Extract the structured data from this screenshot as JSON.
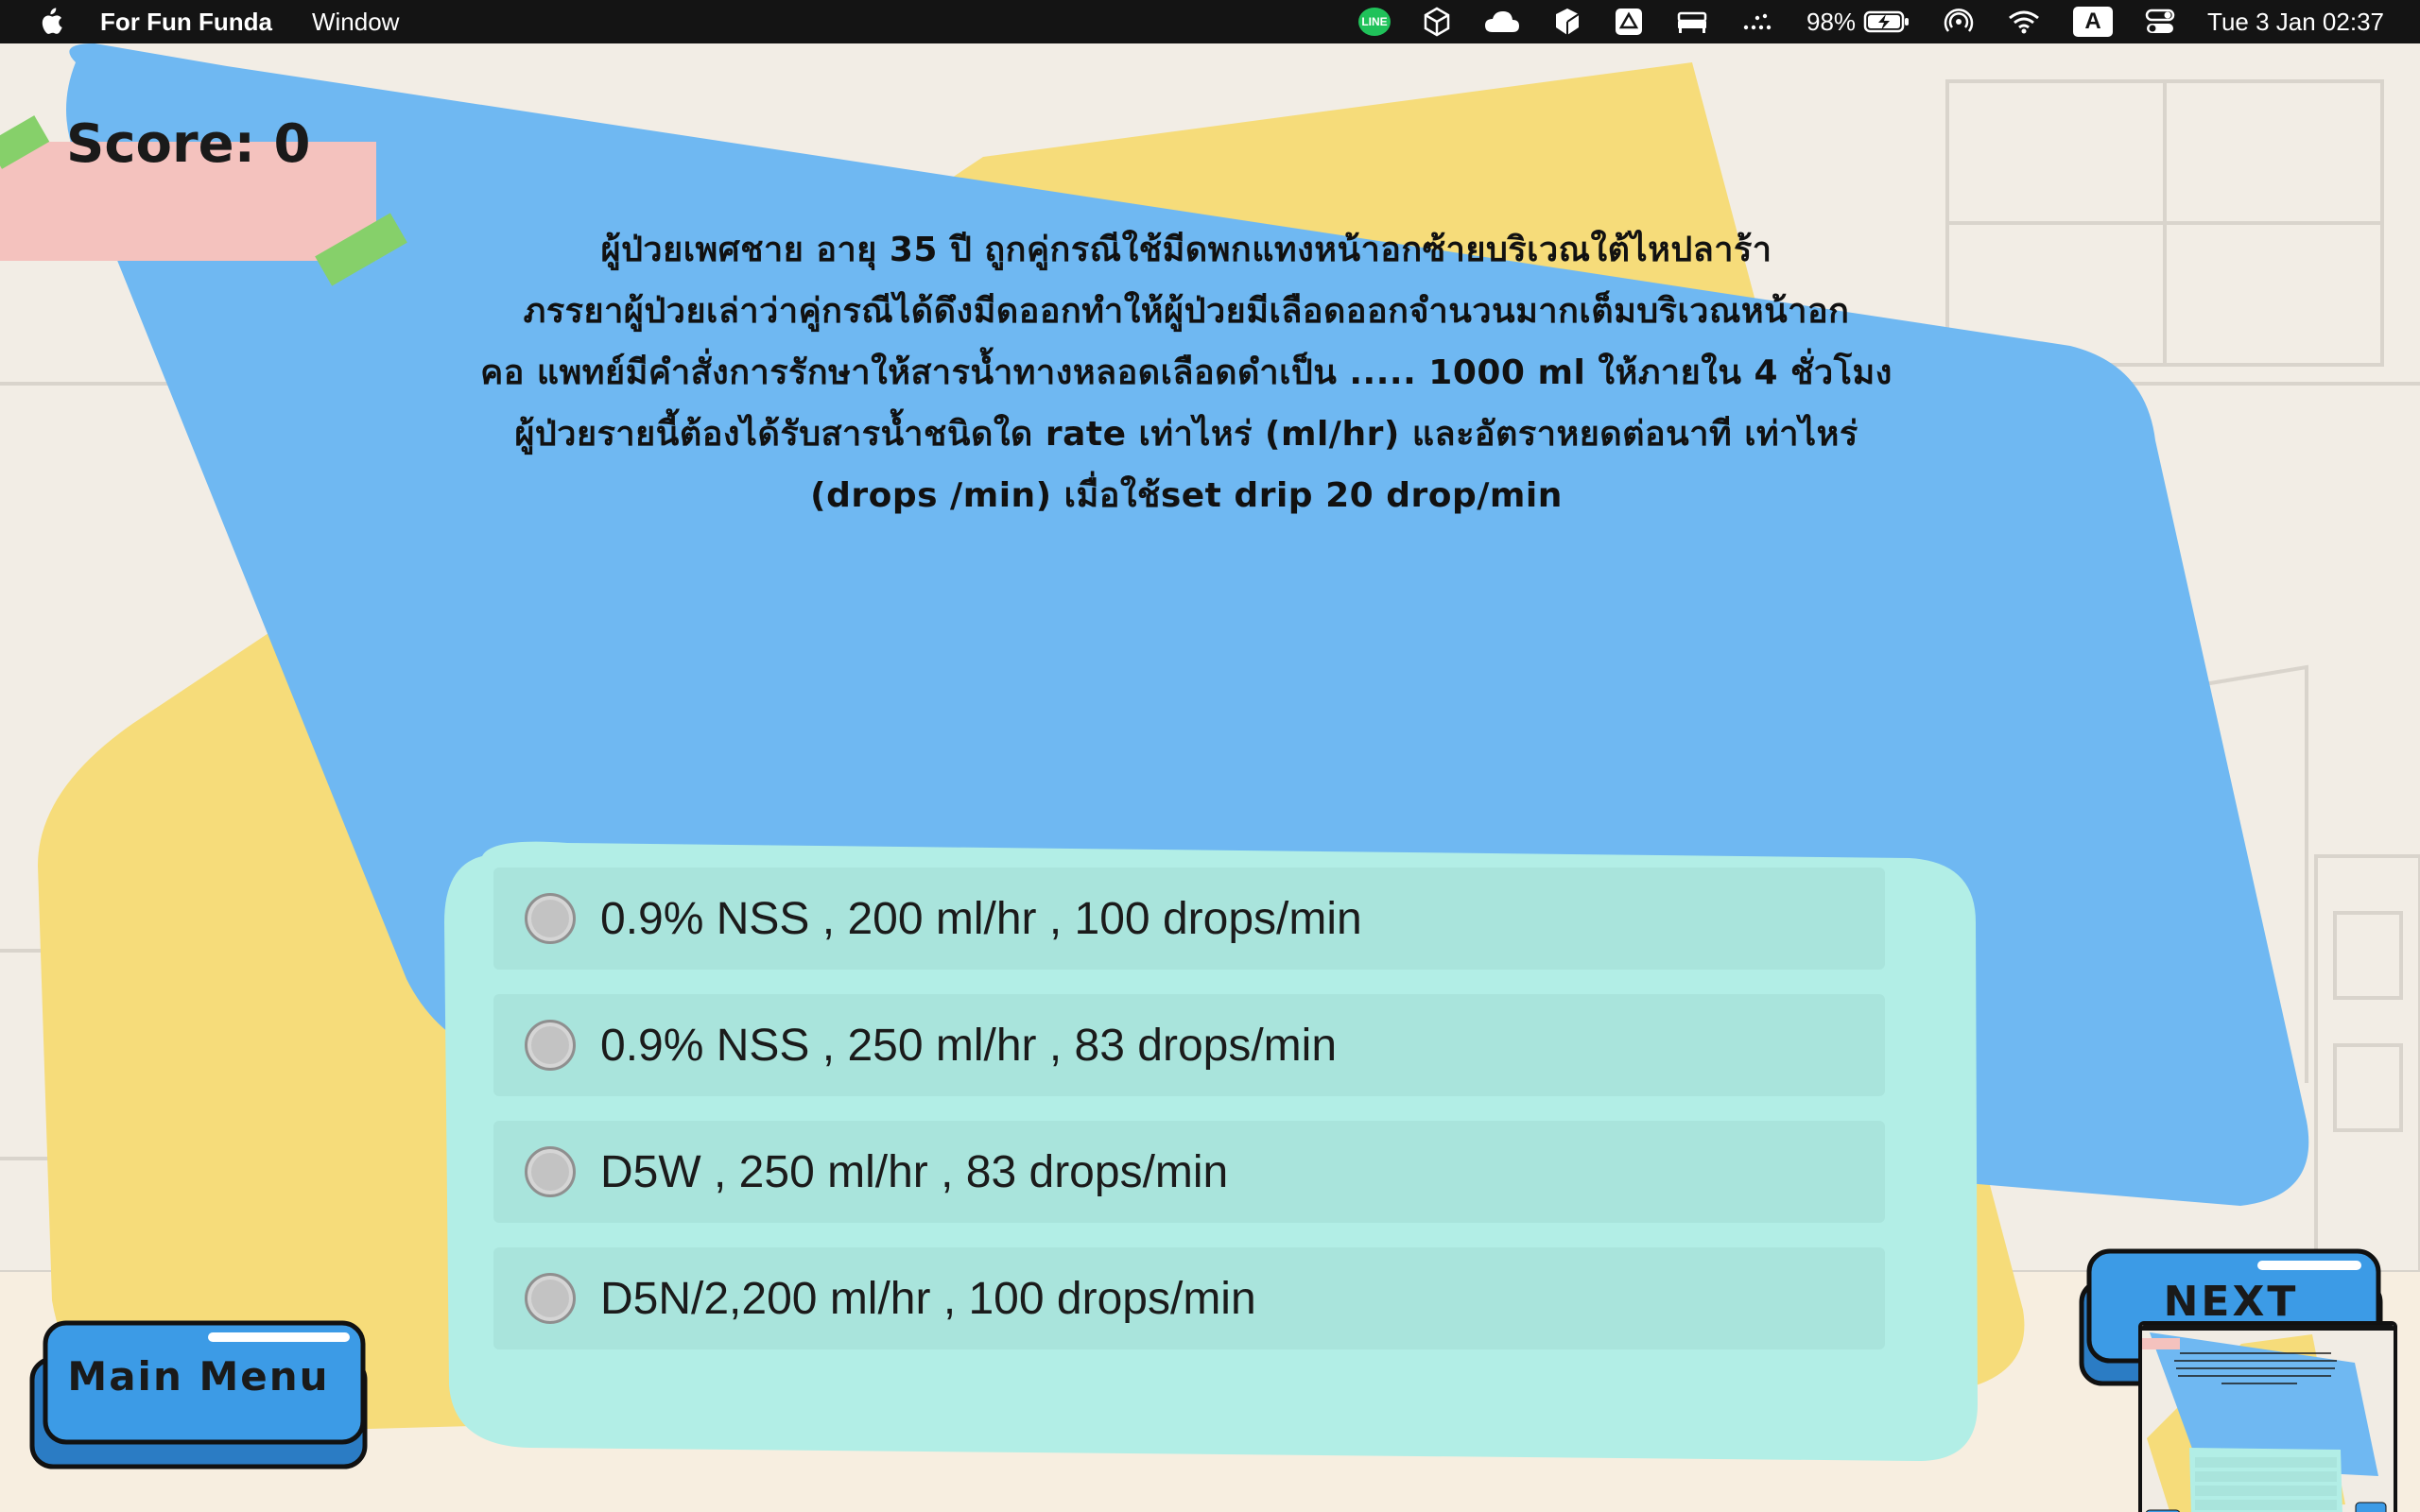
{
  "menubar": {
    "app_name": "For Fun Funda",
    "menus": [
      "Window"
    ],
    "status_icons": [
      "line-icon",
      "unity-icon",
      "cloud-icon",
      "cube-icon",
      "drive-icon",
      "bed-icon",
      "dots-icon",
      "battery-icon",
      "airdrop-icon",
      "wifi-icon",
      "keyboard-a-icon",
      "control-center-icon"
    ],
    "line_label": "LINE",
    "battery": "98%",
    "input_source": "A",
    "clock": "Tue 3 Jan  02:37"
  },
  "game": {
    "score_label": "Score: 0",
    "question_lines": [
      "ผู้ป่วยเพศชาย อายุ 35 ปี ถูกคู่กรณีใช้มีดพกแทงหน้าอกซ้ายบริเวณใต้ไหปลาร้า",
      "ภรรยาผู้ป่วยเล่าว่าคู่กรณีได้ดึงมีดออกทำให้ผู้ป่วยมีเลือดออกจำนวนมากเต็มบริเวณหน้าอก",
      "คอ แพทย์มีคำสั่งการรักษาให้สารน้ำทางหลอดเลือดดำเป็น ..... 1000 ml ให้ภายใน 4 ชั่วโมง",
      "ผู้ป่วยรายนี้ต้องได้รับสารน้ำชนิดใด rate เท่าไหร่ (ml/hr) และอัตราหยดต่อนาที เท่าไหร่",
      "(drops /min) เมื่อใช้set drip 20 drop/min"
    ],
    "options": [
      {
        "label": "0.9% NSS , 200 ml/hr , 100 drops/min"
      },
      {
        "label": "0.9% NSS , 250 ml/hr , 83 drops/min"
      },
      {
        "label": "D5W , 250 ml/hr , 83 drops/min"
      },
      {
        "label": "D5N/2,200 ml/hr , 100 drops/min"
      }
    ],
    "main_menu_label": "Main  Menu",
    "next_label": "NEXT"
  },
  "colors": {
    "menubar": "#141414",
    "blue_panel": "#6fb8f2",
    "yellow_panel": "#f6dc7a",
    "answer_panel": "#b2eee6",
    "option_row": "#a9e4dc",
    "score_tag": "#f4c2be",
    "tape": "#86d06a",
    "button_blue": "#3c9be6"
  }
}
